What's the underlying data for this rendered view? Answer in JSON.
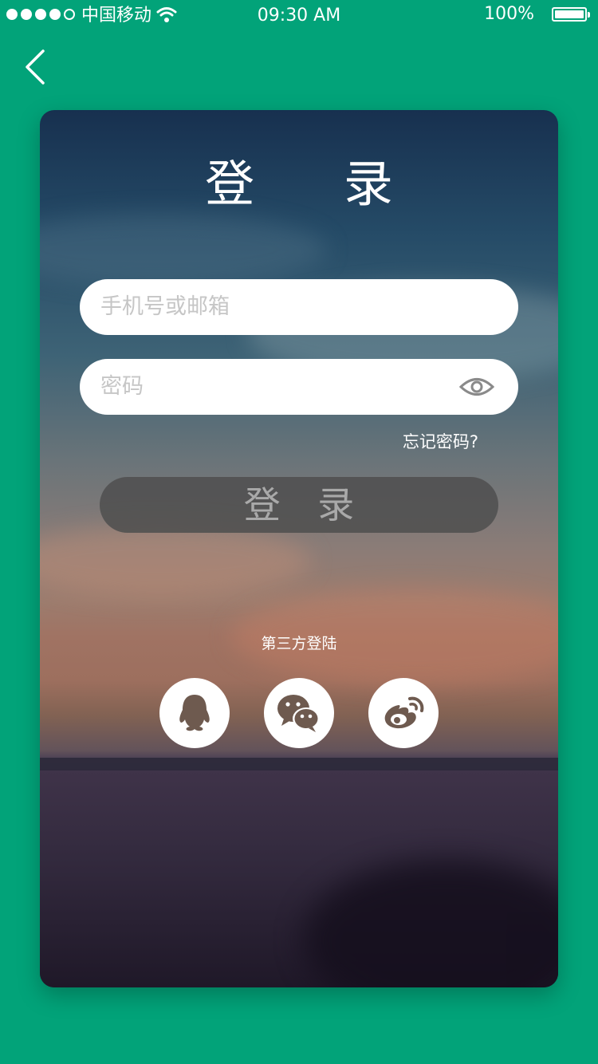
{
  "status_bar": {
    "carrier": "中国移动",
    "time": "09:30 AM",
    "battery": "100%"
  },
  "login": {
    "title": "登 录",
    "phone_placeholder": "手机号或邮箱",
    "password_placeholder": "密码",
    "forgot_password": "忘记密码?",
    "login_button": "登 录",
    "third_party_label": "第三方登陆"
  },
  "colors": {
    "background": "#02a379",
    "icon": "#6e5a4f"
  },
  "icons": [
    "back-icon",
    "eye-icon",
    "qq-icon",
    "wechat-icon",
    "weibo-icon"
  ]
}
